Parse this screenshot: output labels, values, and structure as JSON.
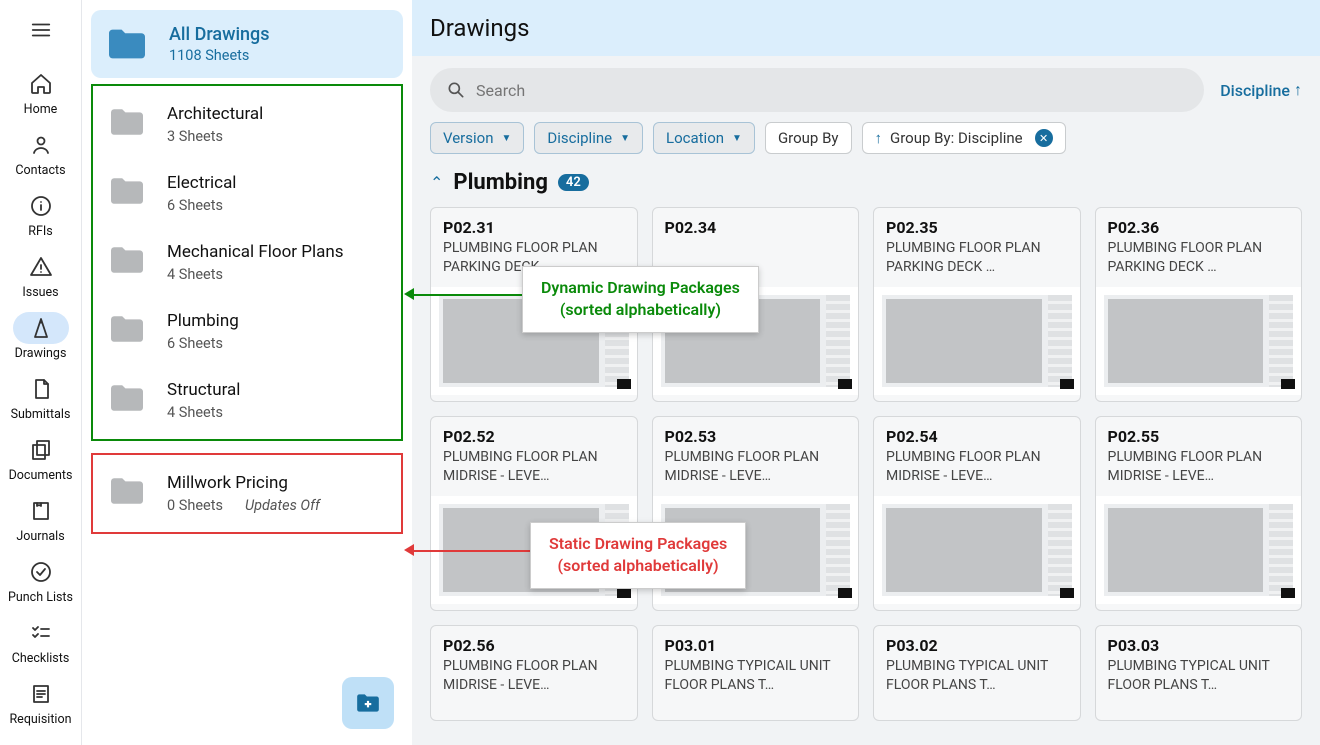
{
  "rail": [
    {
      "label": "Home",
      "icon": "home"
    },
    {
      "label": "Contacts",
      "icon": "person"
    },
    {
      "label": "RFIs",
      "icon": "info"
    },
    {
      "label": "Issues",
      "icon": "warn"
    },
    {
      "label": "Drawings",
      "icon": "compass",
      "active": true
    },
    {
      "label": "Submittals",
      "icon": "doc"
    },
    {
      "label": "Documents",
      "icon": "copy"
    },
    {
      "label": "Journals",
      "icon": "journal"
    },
    {
      "label": "Punch Lists",
      "icon": "check"
    },
    {
      "label": "Checklists",
      "icon": "checklist"
    },
    {
      "label": "Requisition",
      "icon": "req"
    }
  ],
  "allDrawings": {
    "title": "All Drawings",
    "sub": "1108 Sheets"
  },
  "dynamicPackages": [
    {
      "name": "Architectural",
      "sub": "3 Sheets"
    },
    {
      "name": "Electrical",
      "sub": "6 Sheets"
    },
    {
      "name": "Mechanical Floor Plans",
      "sub": "4 Sheets"
    },
    {
      "name": "Plumbing",
      "sub": "6 Sheets"
    },
    {
      "name": "Structural",
      "sub": "4 Sheets"
    }
  ],
  "staticPackages": [
    {
      "name": "Millwork Pricing",
      "sub": "0 Sheets",
      "updates": "Updates Off"
    }
  ],
  "pageTitle": "Drawings",
  "search": {
    "placeholder": "Search"
  },
  "discLink": "Discipline",
  "chips": {
    "version": "Version",
    "discipline": "Discipline",
    "location": "Location",
    "groupBy": "Group By",
    "groupByActive": "Group By: Discipline"
  },
  "group": {
    "name": "Plumbing",
    "count": "42"
  },
  "cards": [
    {
      "code": "P02.31",
      "desc": "PLUMBING FLOOR PLAN PARKING DECK …"
    },
    {
      "code": "P02.34",
      "desc": ""
    },
    {
      "code": "P02.35",
      "desc": "PLUMBING FLOOR PLAN PARKING DECK …"
    },
    {
      "code": "P02.36",
      "desc": "PLUMBING FLOOR PLAN PARKING DECK …"
    },
    {
      "code": "P02.52",
      "desc": "PLUMBING FLOOR PLAN MIDRISE - LEVE…"
    },
    {
      "code": "P02.53",
      "desc": "PLUMBING FLOOR PLAN MIDRISE - LEVE…"
    },
    {
      "code": "P02.54",
      "desc": "PLUMBING FLOOR PLAN MIDRISE - LEVE…"
    },
    {
      "code": "P02.55",
      "desc": "PLUMBING FLOOR PLAN MIDRISE - LEVE…"
    },
    {
      "code": "P02.56",
      "desc": "PLUMBING FLOOR PLAN MIDRISE - LEVE…"
    },
    {
      "code": "P03.01",
      "desc": "PLUMBING TYPICAIL UNIT FLOOR PLANS T…"
    },
    {
      "code": "P03.02",
      "desc": "PLUMBING TYPICAL UNIT FLOOR PLANS T…"
    },
    {
      "code": "P03.03",
      "desc": "PLUMBING TYPICAL UNIT FLOOR PLANS T…"
    }
  ],
  "callout1": {
    "l1": "Dynamic Drawing Packages",
    "l2": "(sorted alphabetically)"
  },
  "callout2": {
    "l1": "Static Drawing Packages",
    "l2": "(sorted alphabetically)"
  }
}
